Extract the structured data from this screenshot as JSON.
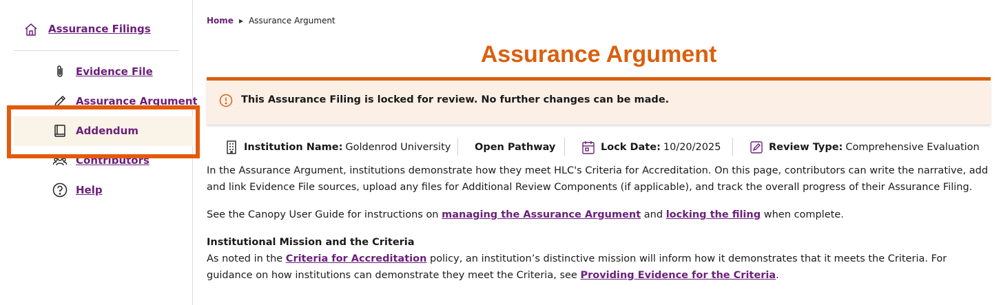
{
  "sidebar": {
    "top": {
      "label": "Assurance Filings",
      "icon": "home-icon"
    },
    "items": [
      {
        "label": "Evidence File",
        "icon": "paperclip-icon"
      },
      {
        "label": "Assurance Argument",
        "icon": "pencil-icon"
      },
      {
        "label": "Addendum",
        "icon": "book-icon"
      },
      {
        "label": "Contributors",
        "icon": "users-icon"
      },
      {
        "label": "Help",
        "icon": "help-circle-icon"
      }
    ]
  },
  "breadcrumb": {
    "home": "Home",
    "current": "Assurance Argument"
  },
  "page": {
    "title": "Assurance Argument"
  },
  "alert": {
    "text": "This Assurance Filing is locked for review. No further changes can be made."
  },
  "meta": {
    "institution_label": "Institution Name:",
    "institution_value": "Goldenrod University",
    "pathway": "Open Pathway",
    "lock_label": "Lock Date:",
    "lock_value": "10/20/2025",
    "review_label": "Review Type:",
    "review_value": "Comprehensive Evaluation"
  },
  "intro": {
    "p1": "In the Assurance Argument, institutions demonstrate how they meet HLC's Criteria for Accreditation. On this page, contributors can write the narrative, add and link Evidence File sources, upload any files for Additional Review Components (if applicable), and track the overall progress of their Assurance Filing.",
    "p2_before": "See the Canopy User Guide for instructions on ",
    "p2_link1": "managing the Assurance Argument",
    "p2_mid": " and ",
    "p2_link2": "locking the filing",
    "p2_after": " when complete."
  },
  "mission": {
    "heading": "Institutional Mission and the Criteria",
    "before": "As noted in the ",
    "link1": "Criteria for Accreditation",
    "mid": " policy, an institution’s distinctive mission will inform how it demonstrates that it meets the Criteria. For guidance on how institutions can demonstrate they meet the Criteria, see ",
    "link2": "Providing Evidence for the Criteria",
    "after": "."
  },
  "colors": {
    "accent": "#d9600f",
    "link": "#6b1f7a",
    "alert_bg": "#fbefe6",
    "highlight": "#e35a0b"
  }
}
